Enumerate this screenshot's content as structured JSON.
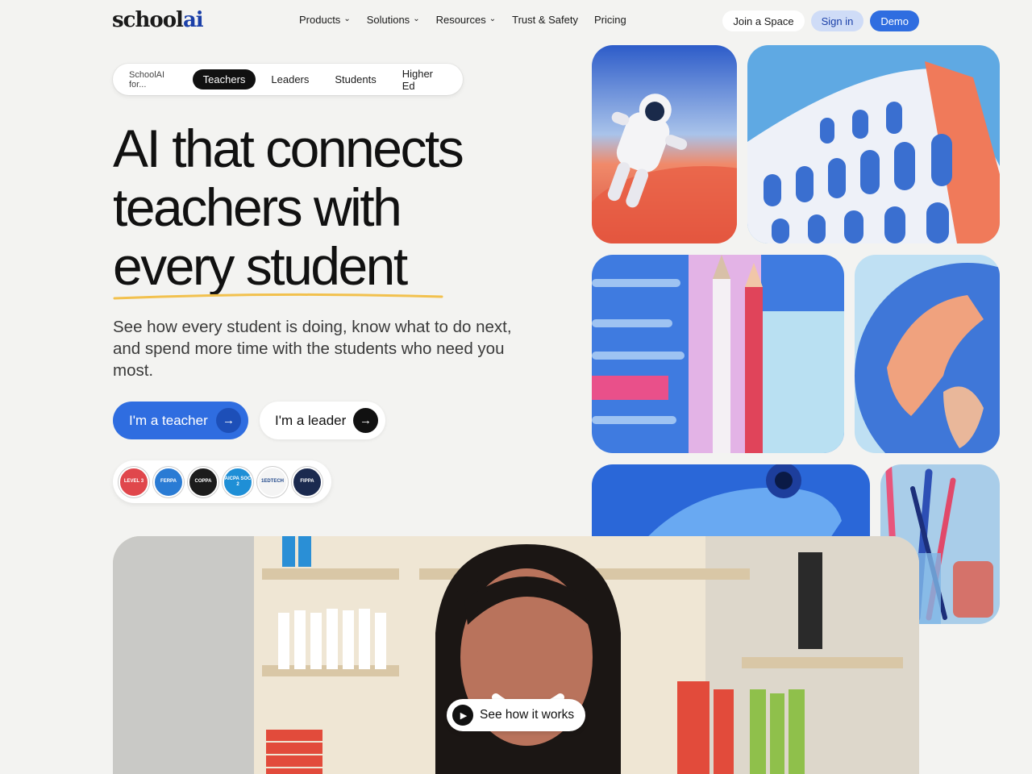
{
  "header": {
    "logo_main": "school",
    "logo_accent": "ai",
    "nav": [
      {
        "label": "Products",
        "has_menu": true
      },
      {
        "label": "Solutions",
        "has_menu": true
      },
      {
        "label": "Resources",
        "has_menu": true
      },
      {
        "label": "Trust & Safety",
        "has_menu": false
      },
      {
        "label": "Pricing",
        "has_menu": false
      }
    ],
    "join_label": "Join a Space",
    "signin_label": "Sign in",
    "demo_label": "Demo"
  },
  "audience": {
    "prefix": "SchoolAI for...",
    "tabs": [
      "Teachers",
      "Leaders",
      "Students",
      "Higher Ed"
    ],
    "active": "Teachers"
  },
  "hero": {
    "headline_line1": "AI that connects",
    "headline_line2": "teachers with",
    "headline_line3": "every student",
    "subtext": "See how every student is doing, know what to do next, and spend more time with the students who need you most.",
    "cta_teacher": "I'm a teacher",
    "cta_leader": "I'm a leader"
  },
  "badges": [
    {
      "icon": "level-badge",
      "text": "LEVEL 3"
    },
    {
      "icon": "ferpa-badge",
      "text": "FERPA"
    },
    {
      "icon": "coppa-badge",
      "text": "COPPA"
    },
    {
      "icon": "aicpa-soc2-badge",
      "text": "AICPA SOC 2"
    },
    {
      "icon": "1edtech-badge",
      "text": "1EDTECH"
    },
    {
      "icon": "fippa-badge",
      "text": "FIPPA"
    }
  ],
  "video": {
    "play_label": "See how it works"
  },
  "colors": {
    "brand_blue": "#2f6de0",
    "accent_yellow": "#f2c14e",
    "background": "#f3f3f1"
  }
}
